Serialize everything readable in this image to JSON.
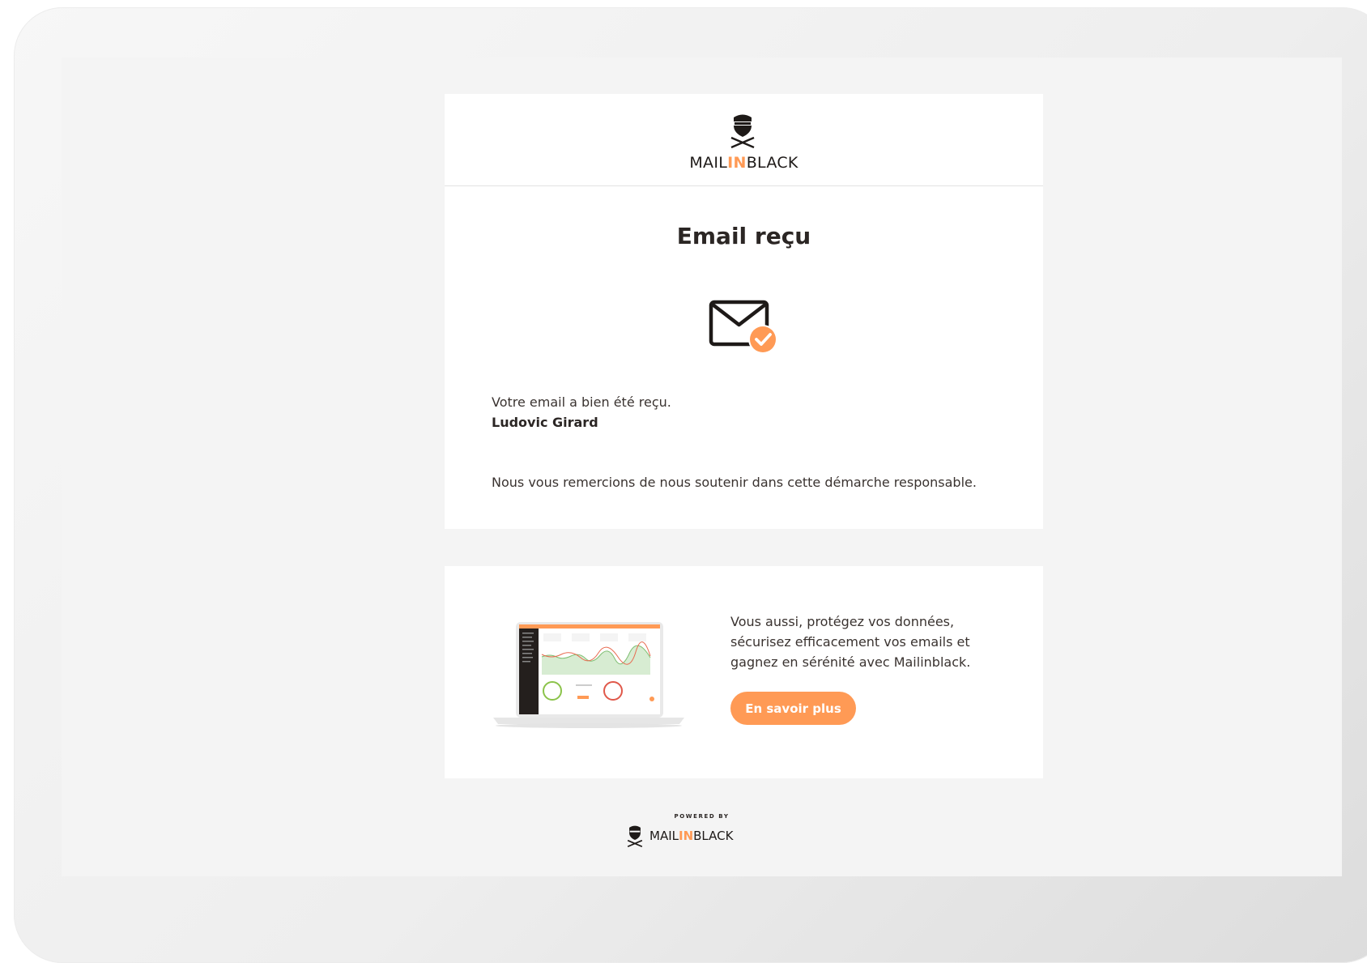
{
  "brand": {
    "name_prefix": "MAIL",
    "name_accent": "IN",
    "name_suffix": "BLACK",
    "accent_color": "#ff9a55",
    "icon": "pirate-mask-icon"
  },
  "main": {
    "title": "Email reçu",
    "status_icon": "envelope-check-icon",
    "message": "Votre email a bien été reçu.",
    "sender_name": "Ludovic Girard",
    "thanks": "Nous vous remercions de nous soutenir dans cette démarche responsable."
  },
  "promo": {
    "image": "laptop-dashboard-illustration",
    "text": "Vous aussi, protégez vos données, sécurisez efficacement vos emails et gagnez en sérénité avec Mailinblack.",
    "button_label": "En savoir plus"
  },
  "footer": {
    "powered_by": "POWERED BY",
    "name_prefix": "MAIL",
    "name_accent": "IN",
    "name_suffix": "BLACK"
  }
}
